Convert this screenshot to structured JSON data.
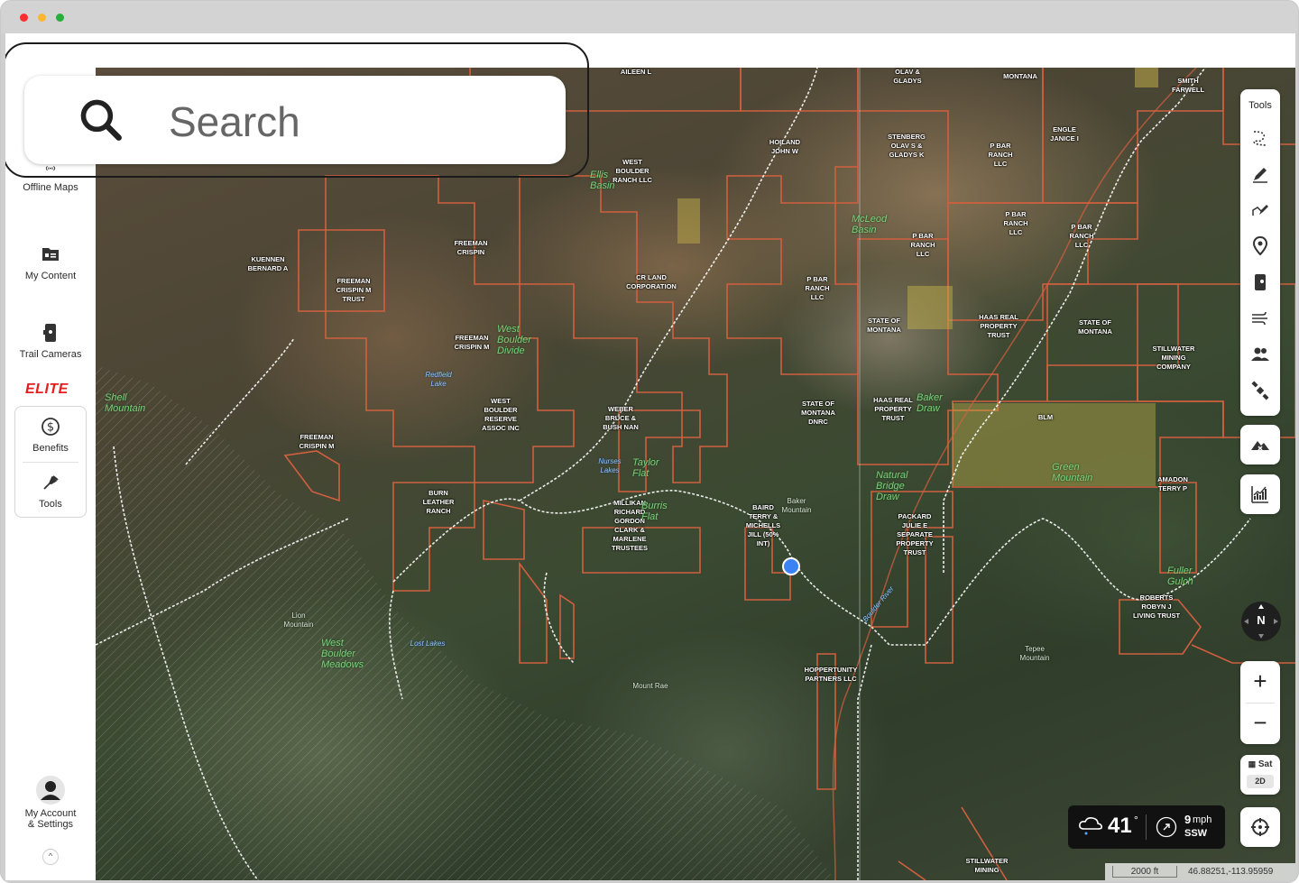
{
  "sidebar": {
    "offline_maps": "Offline Maps",
    "my_content": "My Content",
    "trail_cameras": "Trail Cameras",
    "elite": "ELITE",
    "benefits": "Benefits",
    "tools": "Tools",
    "account_line1": "My Account",
    "account_line2": "& Settings",
    "caret": "^"
  },
  "search": {
    "placeholder": "Search"
  },
  "tools_panel": {
    "title": "Tools",
    "icons": [
      "route-icon",
      "pen-icon",
      "polygon-draw-icon",
      "waypoint-pin-icon",
      "trail-camera-icon",
      "wind-icon",
      "people-icon",
      "satellite-icon"
    ]
  },
  "map_controls": {
    "compass_label": "N",
    "zoom_in": "+",
    "zoom_out": "−",
    "layer_top": "Sat",
    "layer_bottom": "2D"
  },
  "weather": {
    "temperature": "41",
    "degree": "°",
    "wind_speed": "9",
    "wind_unit": "mph",
    "wind_direction": "SSW"
  },
  "scale": {
    "distance": "2000 ft",
    "coordinates": "46.88251,-113.95959"
  },
  "map": {
    "ownership_labels": [
      "AILEEN L",
      "OLAV & GLADYS",
      "MONTANA",
      "SMITH FARWELL",
      "HOILAND JOHN W",
      "STENBERG OLAV S & GLADYS K",
      "P BAR RANCH LLC",
      "ENGLE JANICE I",
      "WEST BOULDER RANCH LLC",
      "P BAR RANCH LLC",
      "P BAR RANCH LLC",
      "P BAR RANCH LLC",
      "FREEMAN CRISPIN",
      "KUENNEN BERNARD A",
      "FREEMAN CRISPIN M TRUST",
      "CR LAND CORPORATION",
      "P BAR RANCH LLC",
      "STATE OF MONTANA",
      "HAAS REAL PROPERTY TRUST",
      "STATE OF MONTANA",
      "FREEMAN CRISPIN M",
      "STILLWATER MINING COMPANY",
      "WEST BOULDER RESERVE ASSOC INC",
      "WEBER BRUCE & BUSH NAN",
      "STATE OF MONTANA DNRC",
      "HAAS REAL PROPERTY TRUST",
      "BLM",
      "FREEMAN CRISPIN M",
      "BURN LEATHER RANCH",
      "MILLIKAN RICHARD GORDON CLARK & MARLENE TRUSTEES",
      "BAIRD TERRY & MICHELLS JILL (50% INT)",
      "PACKARD JULIE E SEPARATE PROPERTY TRUST",
      "AMADON TERRY P",
      "ROBERTS ROBYN J LIVING TRUST",
      "HOPPERTUNITY PARTNERS LLC",
      "STILLWATER MINING"
    ],
    "place_labels": [
      "Ellis Basin",
      "McLeod Basin",
      "West Boulder Divide",
      "Shell Mountain",
      "Taylor Flat",
      "Burris Flat",
      "Baker Draw",
      "Natural Bridge Draw",
      "Green Mountain",
      "Fuller Gulch",
      "West Boulder Meadows",
      "Baker Mountain",
      "Lion Mountain",
      "Tepee Mountain",
      "Mount Rae",
      "Redfield Lake",
      "Nurses Lakes",
      "Lost Lakes",
      "Boulder River"
    ]
  }
}
